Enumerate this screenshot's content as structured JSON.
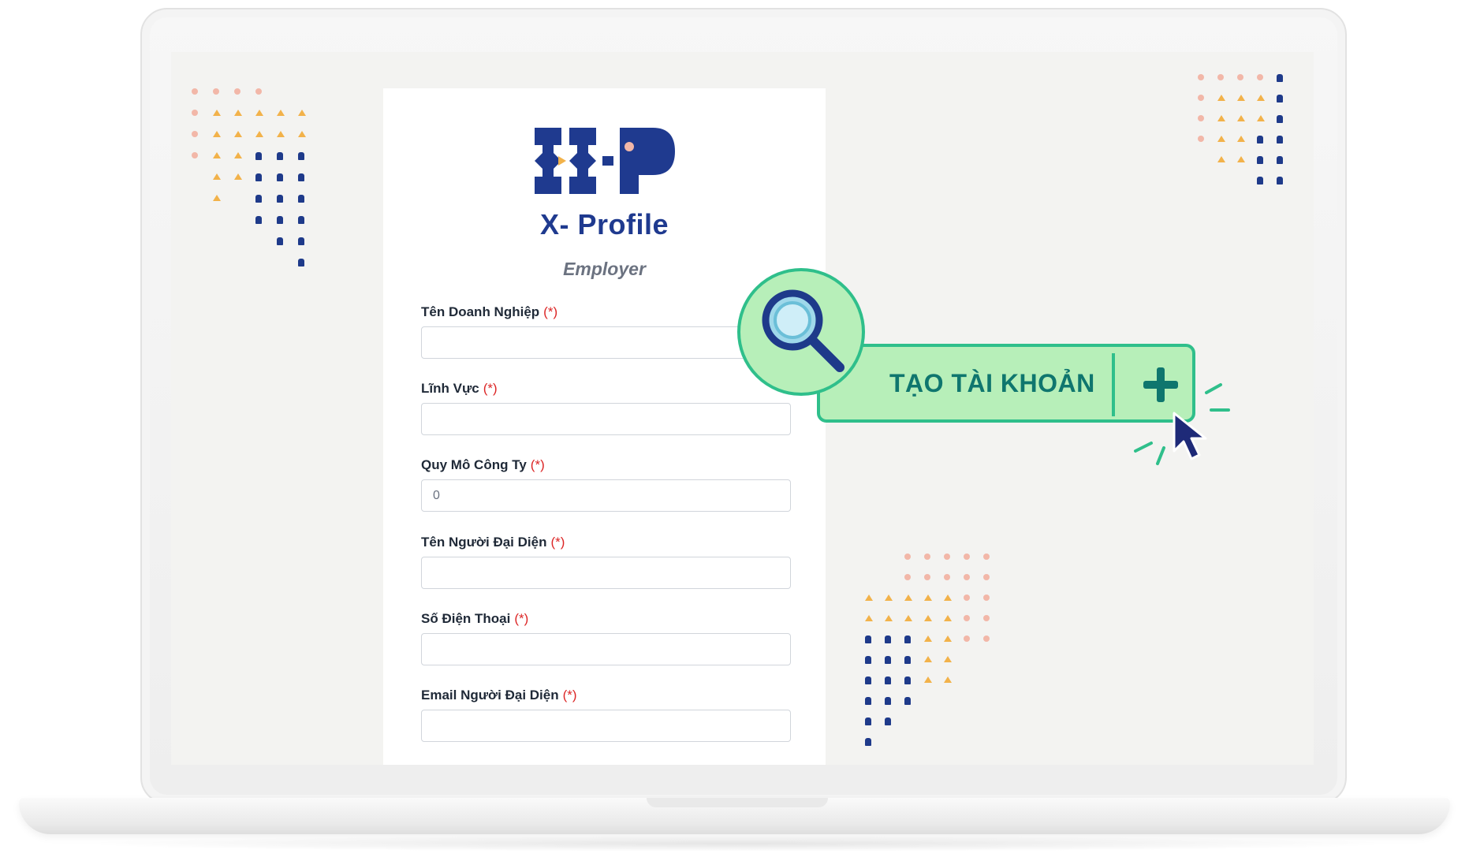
{
  "app": {
    "brand_name": "X- Profile",
    "role": "Employer"
  },
  "form": {
    "required_marker": "(*)",
    "fields": [
      {
        "label": "Tên Doanh Nghiệp",
        "value": "",
        "placeholder": ""
      },
      {
        "label": "Lĩnh Vực",
        "value": "",
        "placeholder": ""
      },
      {
        "label": "Quy Mô Công Ty",
        "value": "",
        "placeholder": "0"
      },
      {
        "label": "Tên Người Đại Diện",
        "value": "",
        "placeholder": ""
      },
      {
        "label": "Số Điện Thoại",
        "value": "",
        "placeholder": ""
      },
      {
        "label": "Email Người Đại Diện",
        "value": "",
        "placeholder": ""
      }
    ]
  },
  "overlay": {
    "create_account_label": "TẠO TÀI KHOẢN",
    "icons": [
      "search-icon",
      "plus-icon",
      "cursor-icon"
    ]
  },
  "colors": {
    "brand_blue": "#1f3a8f",
    "accent_green": "#2fbf8b",
    "callout_fill": "#b7efb9",
    "required_red": "#dc2626"
  }
}
